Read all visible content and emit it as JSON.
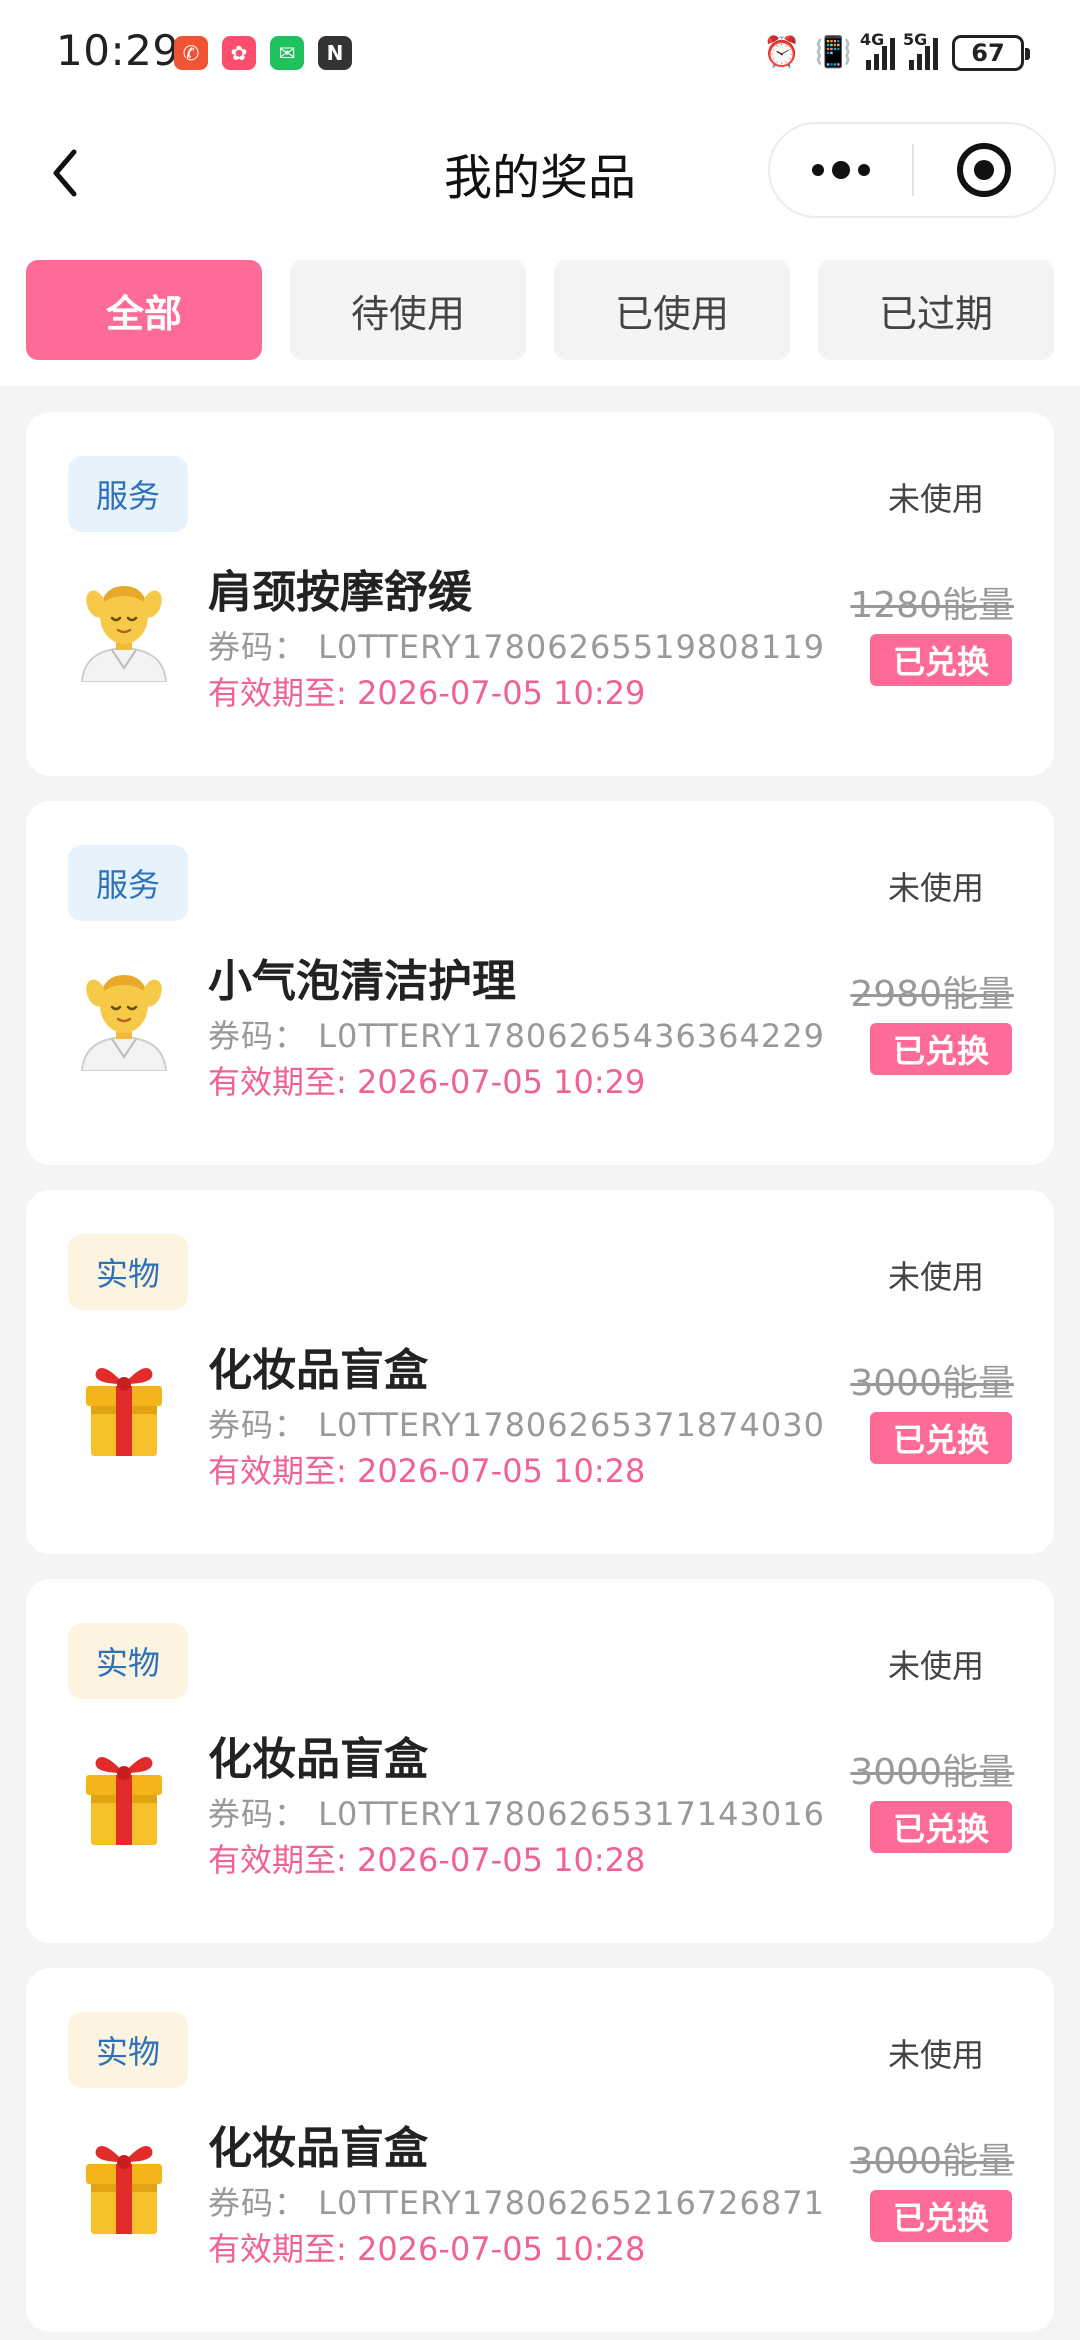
{
  "status_bar": {
    "time": "10:29",
    "notification_icons": [
      {
        "name": "missed-call-icon",
        "color": "#ef5535",
        "glyph": "✆"
      },
      {
        "name": "app-badge-icon",
        "color": "#ff4d6d",
        "glyph": "✿"
      },
      {
        "name": "wechat-icon",
        "color": "#21c25e",
        "glyph": "✉"
      },
      {
        "name": "nfc-icon",
        "color": "#333333",
        "glyph": "N"
      }
    ],
    "network_4g": "4G",
    "network_5g": "5G",
    "battery": "67"
  },
  "navbar": {
    "title": "我的奖品"
  },
  "tabs": [
    {
      "label": "全部",
      "active": true
    },
    {
      "label": "待使用",
      "active": false
    },
    {
      "label": "已使用",
      "active": false
    },
    {
      "label": "已过期",
      "active": false
    }
  ],
  "accent_color": "#ff6b97",
  "prizes": [
    {
      "category": "服务",
      "category_type": "service",
      "icon": "massage-person-icon",
      "status": "未使用",
      "name": "肩颈按摩舒缓",
      "code": "券码： L0TTERY17806265519808119",
      "expiry": "有效期至: 2026-07-05 10:29",
      "cost": "1280能量",
      "badge": "已兑换"
    },
    {
      "category": "服务",
      "category_type": "service",
      "icon": "massage-person-icon",
      "status": "未使用",
      "name": "小气泡清洁护理",
      "code": "券码： L0TTERY17806265436364229",
      "expiry": "有效期至: 2026-07-05 10:29",
      "cost": "2980能量",
      "badge": "已兑换"
    },
    {
      "category": "实物",
      "category_type": "goods",
      "icon": "gift-box-icon",
      "status": "未使用",
      "name": "化妆品盲盒",
      "code": "券码： L0TTERY17806265371874030",
      "expiry": "有效期至: 2026-07-05 10:28",
      "cost": "3000能量",
      "badge": "已兑换"
    },
    {
      "category": "实物",
      "category_type": "goods",
      "icon": "gift-box-icon",
      "status": "未使用",
      "name": "化妆品盲盒",
      "code": "券码： L0TTERY17806265317143016",
      "expiry": "有效期至: 2026-07-05 10:28",
      "cost": "3000能量",
      "badge": "已兑换"
    },
    {
      "category": "实物",
      "category_type": "goods",
      "icon": "gift-box-icon",
      "status": "未使用",
      "name": "化妆品盲盒",
      "code": "券码： L0TTERY17806265216726871",
      "expiry": "有效期至: 2026-07-05 10:28",
      "cost": "3000能量",
      "badge": "已兑换"
    }
  ]
}
